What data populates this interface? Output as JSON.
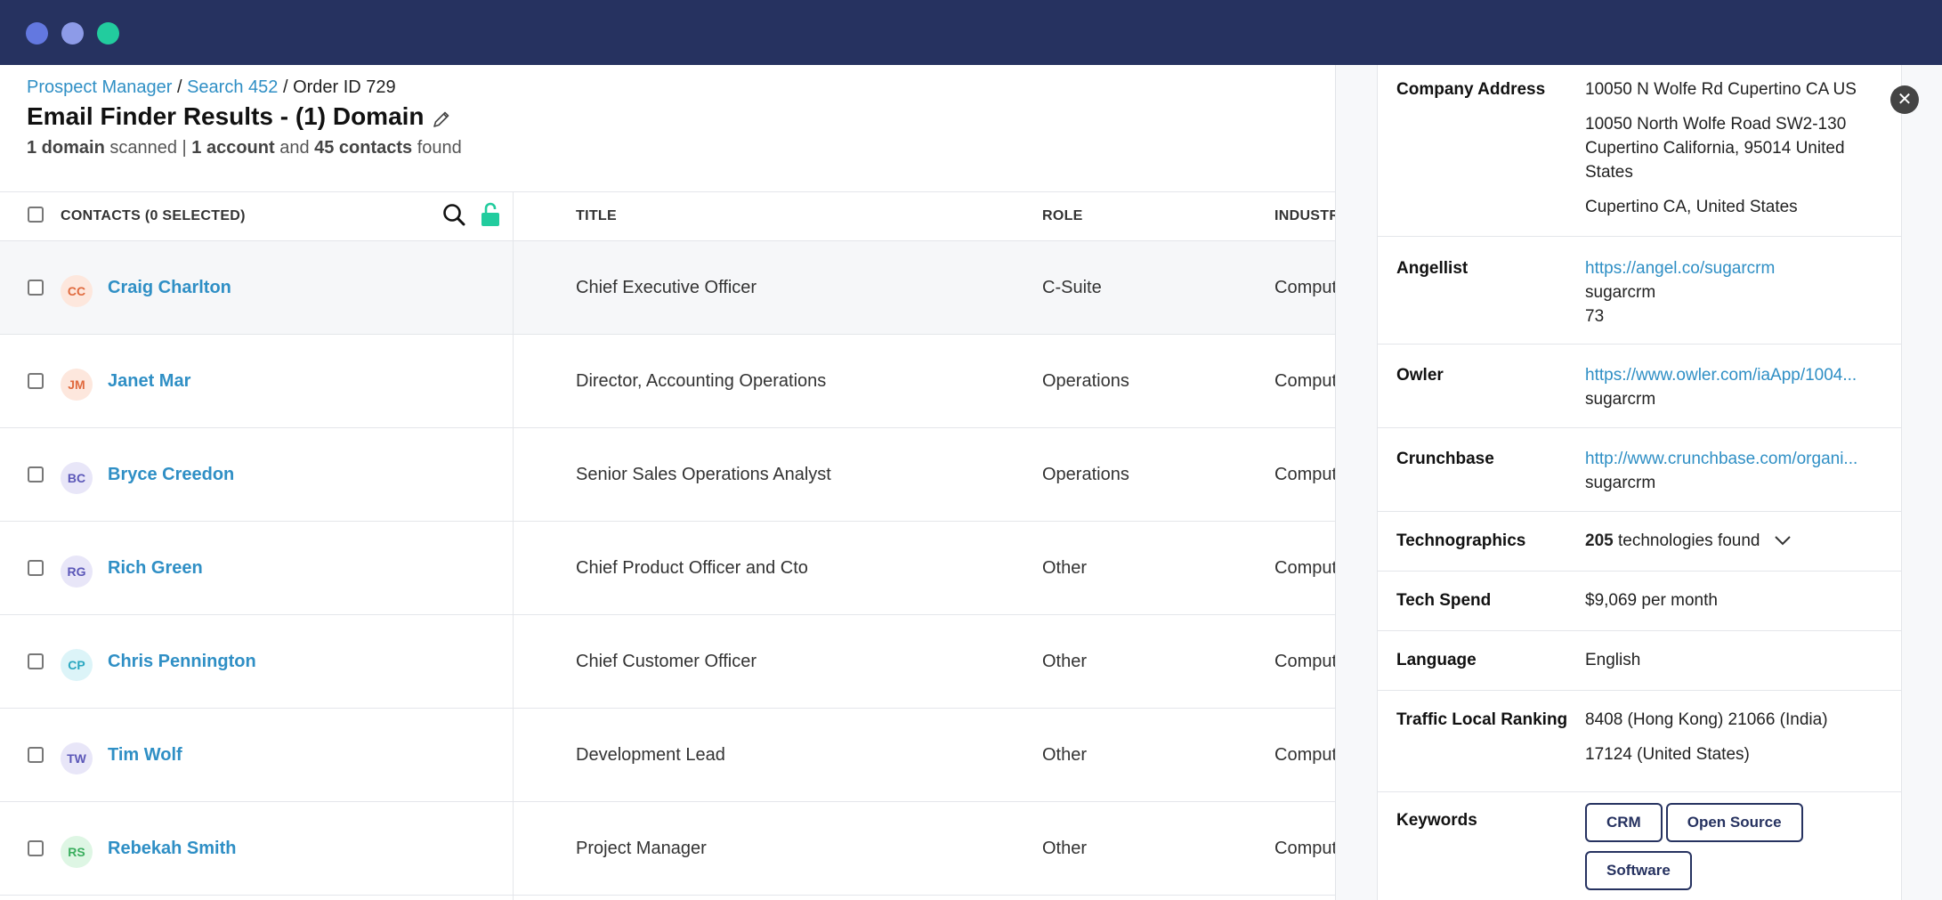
{
  "window": {
    "dot_colors": [
      "#6378e0",
      "#8d9be8",
      "#22cc9e"
    ]
  },
  "breadcrumb": {
    "item1": "Prospect Manager",
    "sep": " / ",
    "item2": "Search 452",
    "current": "Order ID 729"
  },
  "title": "Email Finder Results - (1) Domain",
  "summary": {
    "n1": "1 domain",
    "t1": " scanned | ",
    "n2": "1 account",
    "t2": " and ",
    "n3": "45 contacts",
    "t3": " found"
  },
  "table": {
    "headers": {
      "contacts": "CONTACTS (0 SELECTED)",
      "title": "TITLE",
      "role": "ROLE",
      "industry": "INDUSTR"
    },
    "rows": [
      {
        "initials": "CC",
        "name": "Craig Charlton",
        "title": "Chief Executive Officer",
        "role": "C-Suite",
        "industry": "Comput",
        "avatar_bg": "#fde7dd",
        "avatar_fg": "#e06a3e"
      },
      {
        "initials": "JM",
        "name": "Janet Mar",
        "title": "Director, Accounting Operations",
        "role": "Operations",
        "industry": "Comput",
        "avatar_bg": "#fde7dd",
        "avatar_fg": "#e06a3e"
      },
      {
        "initials": "BC",
        "name": "Bryce Creedon",
        "title": "Senior Sales Operations Analyst",
        "role": "Operations",
        "industry": "Comput",
        "avatar_bg": "#e8e6f8",
        "avatar_fg": "#5b57b8"
      },
      {
        "initials": "RG",
        "name": "Rich Green",
        "title": "Chief Product Officer and Cto",
        "role": "Other",
        "industry": "Comput",
        "avatar_bg": "#e8e6f8",
        "avatar_fg": "#5b57b8"
      },
      {
        "initials": "CP",
        "name": "Chris Pennington",
        "title": "Chief Customer Officer",
        "role": "Other",
        "industry": "Comput",
        "avatar_bg": "#dcf4f8",
        "avatar_fg": "#2aa7c0"
      },
      {
        "initials": "TW",
        "name": "Tim Wolf",
        "title": "Development Lead",
        "role": "Other",
        "industry": "Comput",
        "avatar_bg": "#e8e6f8",
        "avatar_fg": "#5b57b8"
      },
      {
        "initials": "RS",
        "name": "Rebekah Smith",
        "title": "Project Manager",
        "role": "Other",
        "industry": "Comput",
        "avatar_bg": "#def6e4",
        "avatar_fg": "#3aae5e"
      }
    ]
  },
  "panel": {
    "address": {
      "label": "Company Address",
      "lines": [
        "10050 N Wolfe Rd Cupertino CA US",
        "10050 North Wolfe Road SW2-130 Cupertino California, 95014 United States",
        "Cupertino CA, United States"
      ]
    },
    "angellist": {
      "label": "Angellist",
      "url": "https://angel.co/sugarcrm",
      "handle": "sugarcrm",
      "count": "73"
    },
    "owler": {
      "label": "Owler",
      "url": "https://www.owler.com/iaApp/1004...",
      "handle": "sugarcrm"
    },
    "crunchbase": {
      "label": "Crunchbase",
      "url": "http://www.crunchbase.com/organi...",
      "handle": "sugarcrm"
    },
    "technographics": {
      "label": "Technographics",
      "count": "205",
      "text": " technologies found"
    },
    "techspend": {
      "label": "Tech Spend",
      "value": "$9,069 per month"
    },
    "language": {
      "label": "Language",
      "value": "English"
    },
    "traffic": {
      "label": "Traffic Local Ranking",
      "line1": "8408 (Hong Kong) 21066 (India)",
      "line2": "17124 (United States)"
    },
    "keywords": {
      "label": "Keywords",
      "items": [
        "CRM",
        "Open Source",
        "Software"
      ]
    }
  },
  "colors": {
    "accent": "#2f8fc5",
    "topbar": "#263260",
    "unlock": "#22cc9e"
  }
}
